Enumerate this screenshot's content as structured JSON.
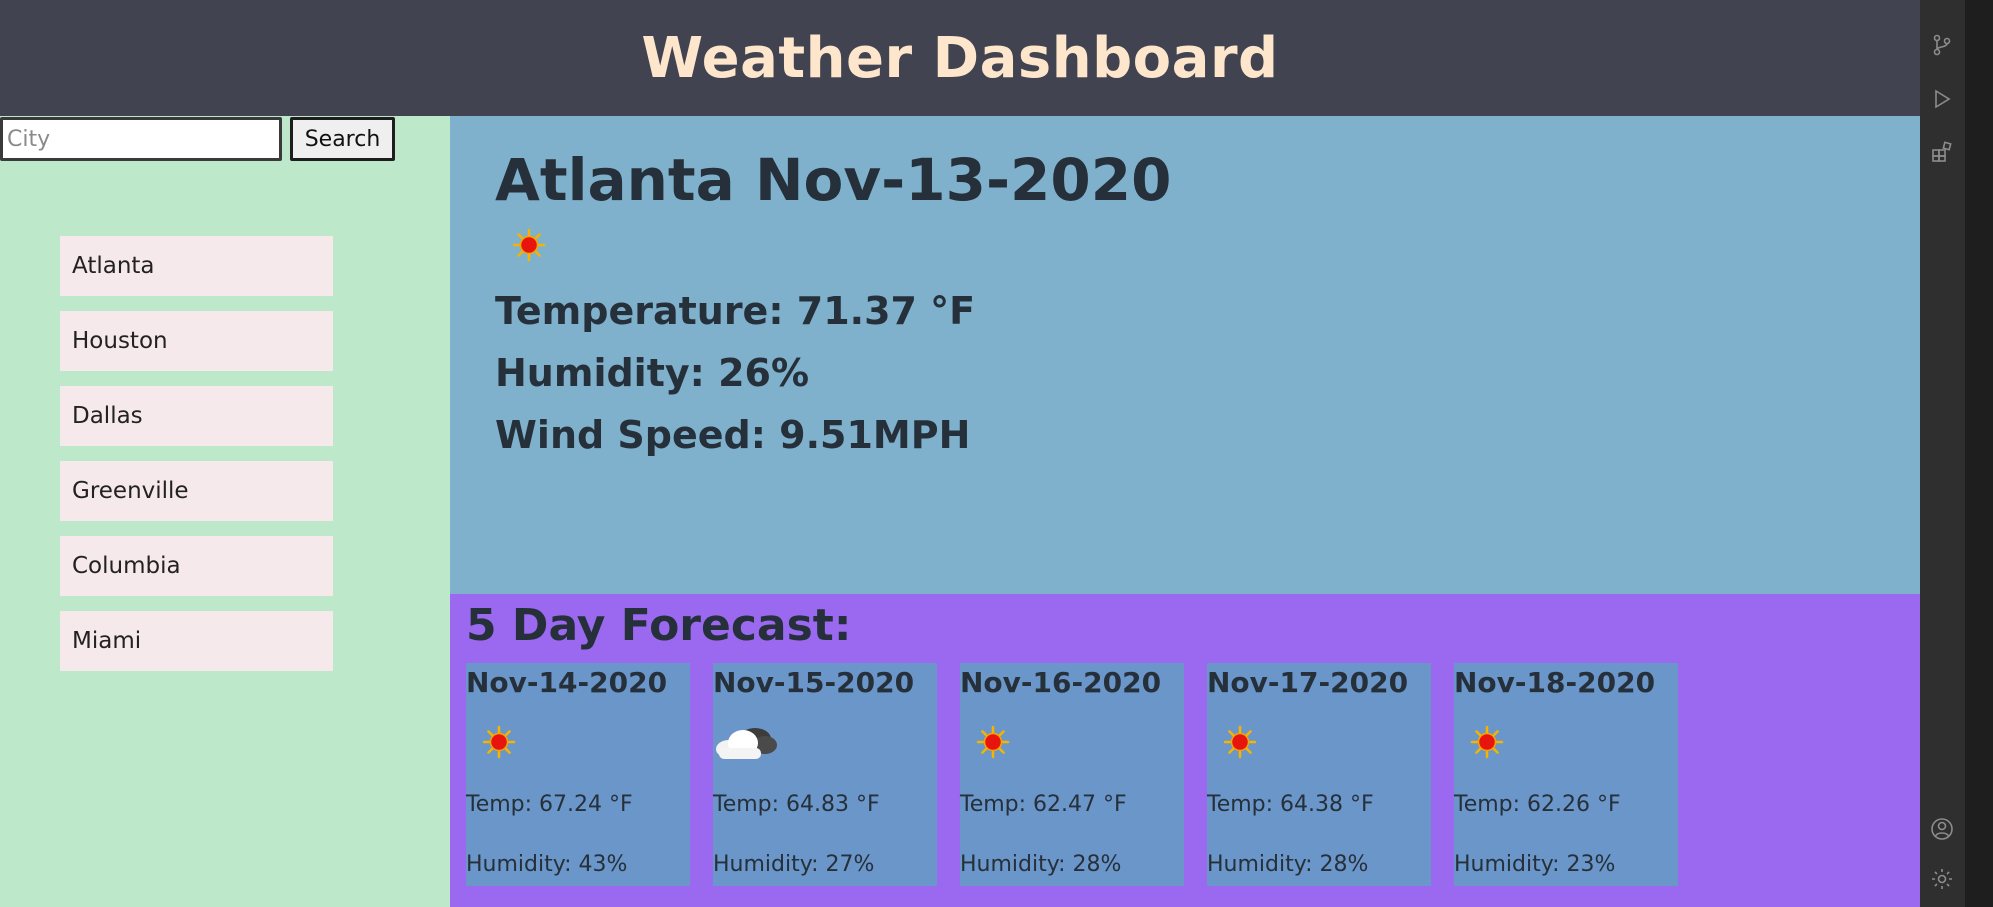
{
  "header": {
    "title": "Weather Dashboard"
  },
  "search": {
    "placeholder": "City",
    "value": "",
    "button_label": "Search"
  },
  "history": [
    "Atlanta",
    "Houston",
    "Dallas",
    "Greenville",
    "Columbia",
    "Miami"
  ],
  "current": {
    "heading": "Atlanta Nov-13-2020",
    "icon": "sun-icon",
    "temperature": "Temperature: 71.37 °F",
    "humidity": "Humidity: 26%",
    "wind": "Wind Speed: 9.51MPH"
  },
  "forecast": {
    "heading": "5 Day Forecast:",
    "days": [
      {
        "date": "Nov-14-2020",
        "icon": "sun-icon",
        "temp": "Temp: 67.24 °F",
        "humidity": "Humidity: 43%"
      },
      {
        "date": "Nov-15-2020",
        "icon": "cloud-icon",
        "temp": "Temp: 64.83 °F",
        "humidity": "Humidity: 27%"
      },
      {
        "date": "Nov-16-2020",
        "icon": "sun-icon",
        "temp": "Temp: 62.47 °F",
        "humidity": "Humidity: 28%"
      },
      {
        "date": "Nov-17-2020",
        "icon": "sun-icon",
        "temp": "Temp: 64.38 °F",
        "humidity": "Humidity: 28%"
      },
      {
        "date": "Nov-18-2020",
        "icon": "sun-icon",
        "temp": "Temp: 62.26 °F",
        "humidity": "Humidity: 23%"
      }
    ]
  },
  "colors": {
    "header_bg": "#414350",
    "title": "#fde6cc",
    "sidebar_bg": "#bde8c9",
    "current_bg": "#7fb1cc",
    "forecast_bg": "#9a69f0",
    "card_bg": "#6b96c9",
    "history_item_bg": "#f6e9ec"
  }
}
